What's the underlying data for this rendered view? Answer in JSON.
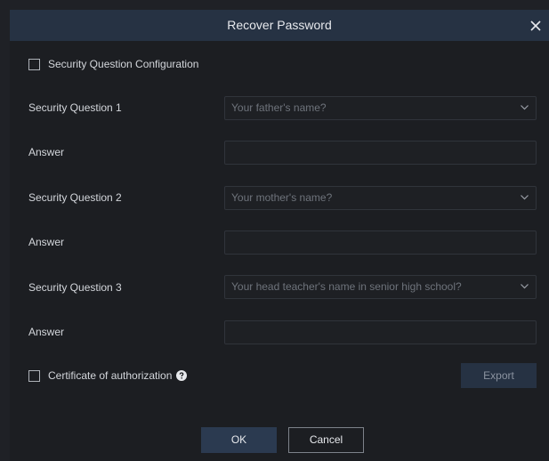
{
  "dialog": {
    "title": "Recover Password"
  },
  "security_config": {
    "label": "Security Question Configuration",
    "checked": false
  },
  "questions": [
    {
      "label": "Security Question 1",
      "selected": "Your father's name?",
      "answer_label": "Answer",
      "answer_value": ""
    },
    {
      "label": "Security Question 2",
      "selected": "Your mother's name?",
      "answer_label": "Answer",
      "answer_value": ""
    },
    {
      "label": "Security Question 3",
      "selected": "Your head teacher's name in senior high school?",
      "answer_label": "Answer",
      "answer_value": ""
    }
  ],
  "certificate": {
    "label": "Certificate of authorization",
    "checked": false,
    "export_label": "Export"
  },
  "footer": {
    "ok_label": "OK",
    "cancel_label": "Cancel"
  },
  "icons": {
    "close": "close-icon",
    "help": "question-circle-icon",
    "dropdown": "chevron-down-icon"
  },
  "colors": {
    "background": "#1c1e22",
    "titlebar": "#263243",
    "primary_button": "#2b3a50",
    "text": "#d3d6db",
    "placeholder": "#6e737b"
  }
}
